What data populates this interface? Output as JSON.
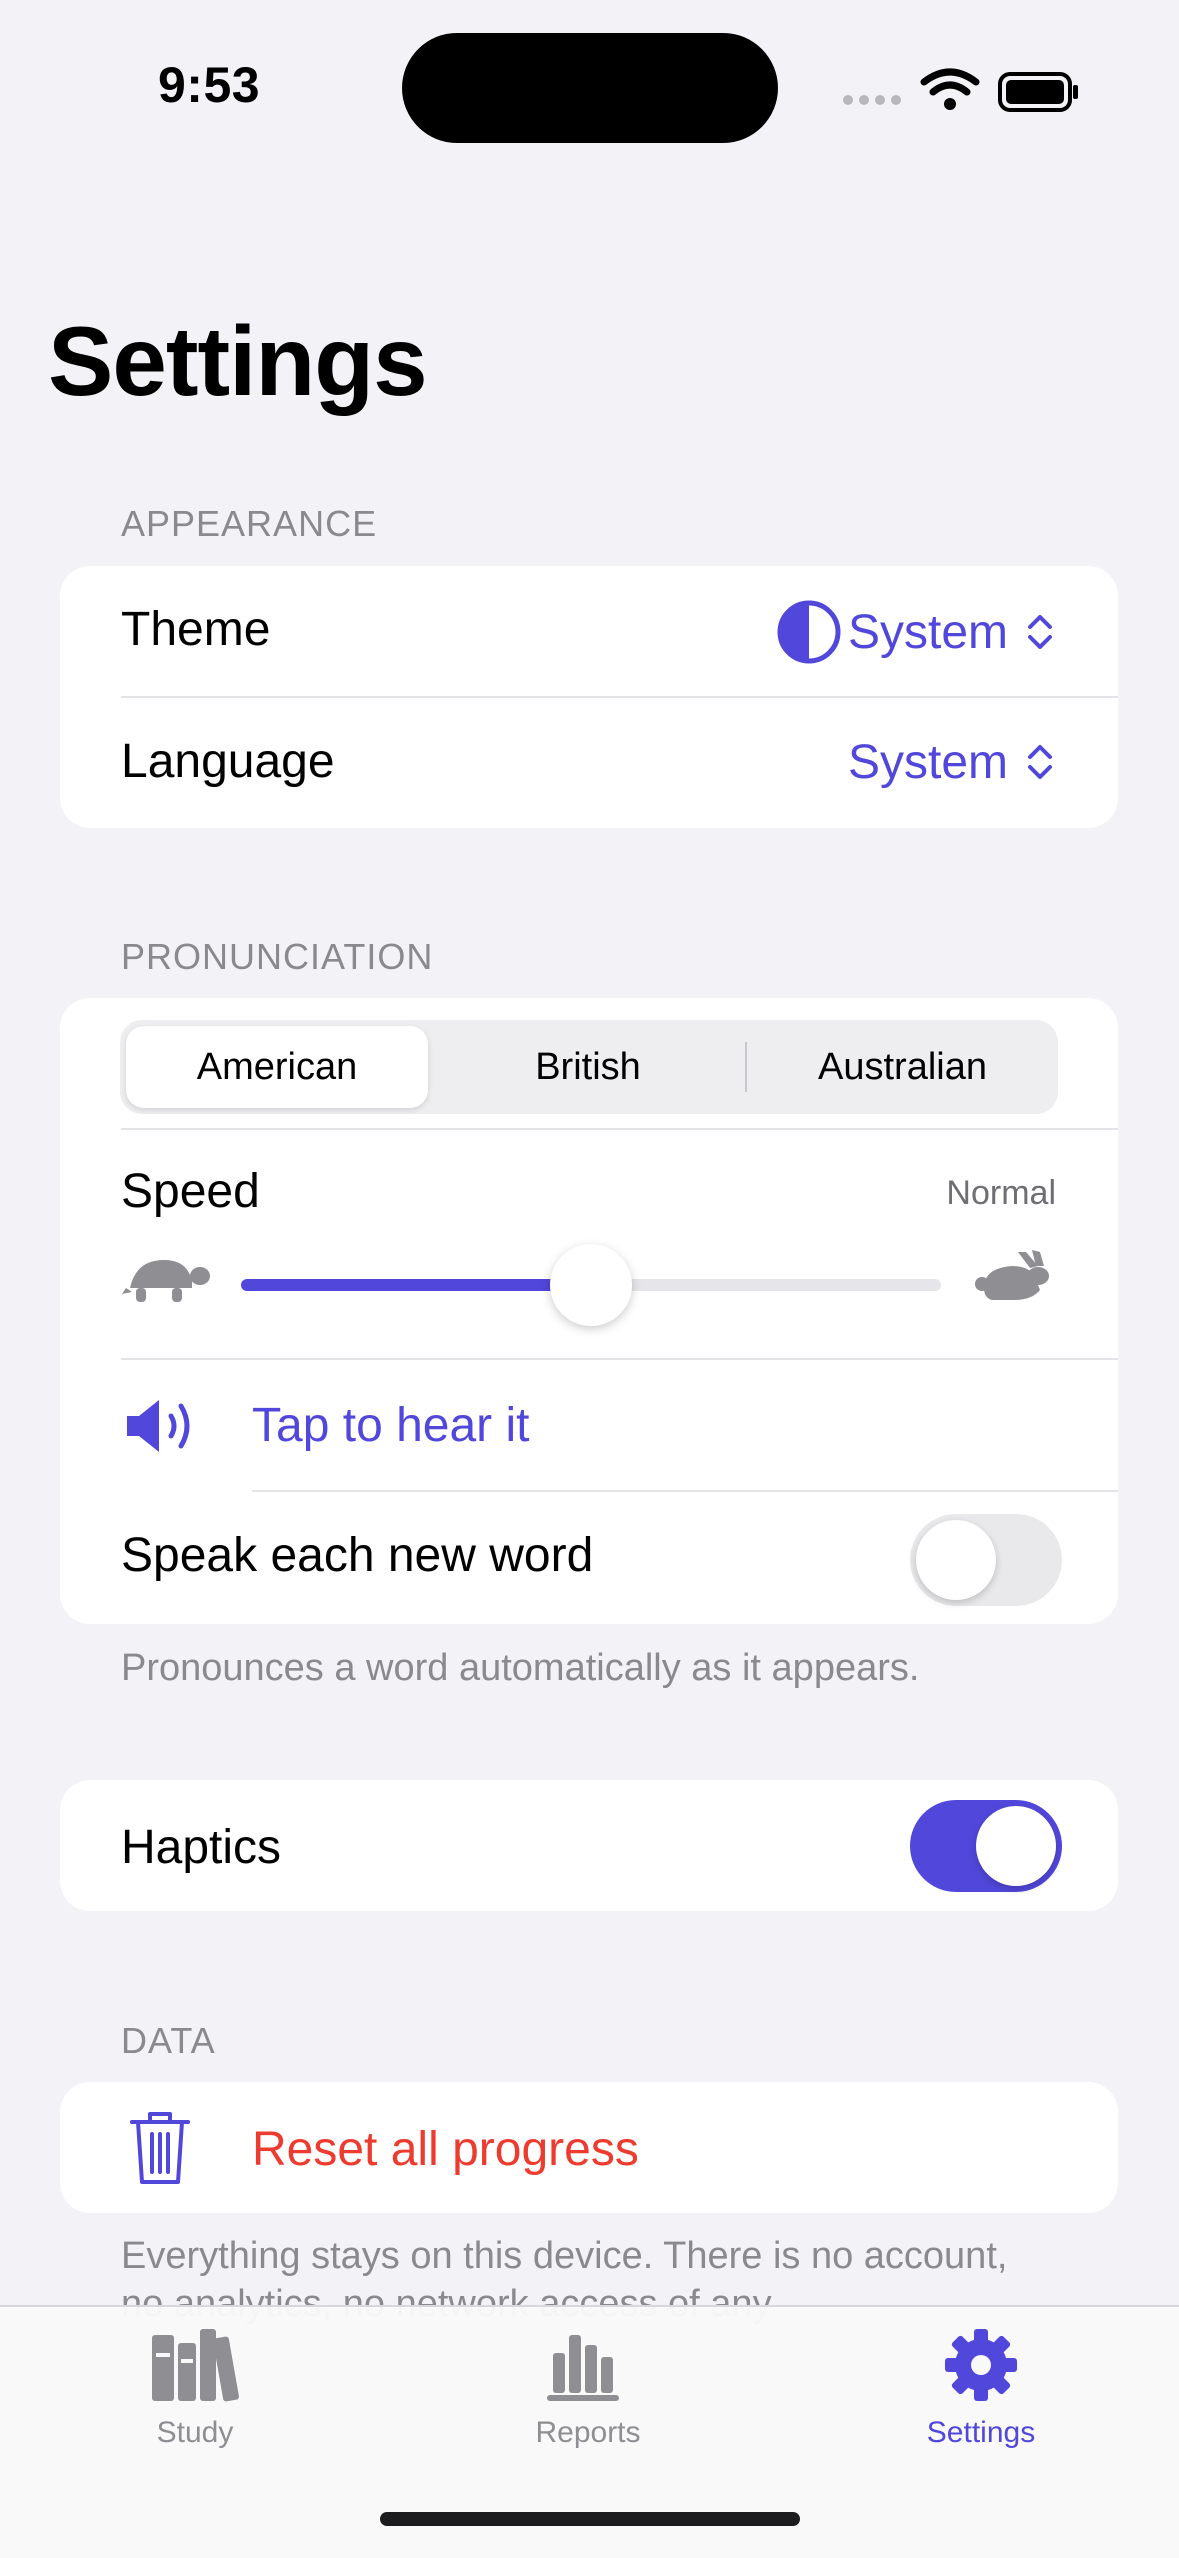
{
  "status": {
    "time": "9:53"
  },
  "title": "Settings",
  "appearance": {
    "header": "APPEARANCE",
    "theme_label": "Theme",
    "theme_value": "System",
    "language_label": "Language",
    "language_value": "System"
  },
  "pronunciation": {
    "header": "PRONUNCIATION",
    "accents": [
      "American",
      "British",
      "Australian"
    ],
    "selected_accent": "American",
    "speed_label": "Speed",
    "speed_value": "Normal",
    "speed_level": 0.5,
    "tap_to_hear": "Tap to hear it",
    "speak_each_label": "Speak each new word",
    "speak_each_on": false,
    "footer": "Pronounces a word automatically as it appears."
  },
  "haptics": {
    "label": "Haptics",
    "on": true
  },
  "data": {
    "header": "DATA",
    "reset_label": "Reset all progress",
    "footer": "Everything stays on this device. There is no account, no analytics, no network access of any"
  },
  "tabs": [
    {
      "label": "Study",
      "icon": "books-icon"
    },
    {
      "label": "Reports",
      "icon": "bar-chart-icon"
    },
    {
      "label": "Settings",
      "icon": "gear-icon"
    }
  ],
  "colors": {
    "accent": "#5147DB",
    "destructive": "#EE3B2F",
    "inactive": "#8E8E93"
  }
}
